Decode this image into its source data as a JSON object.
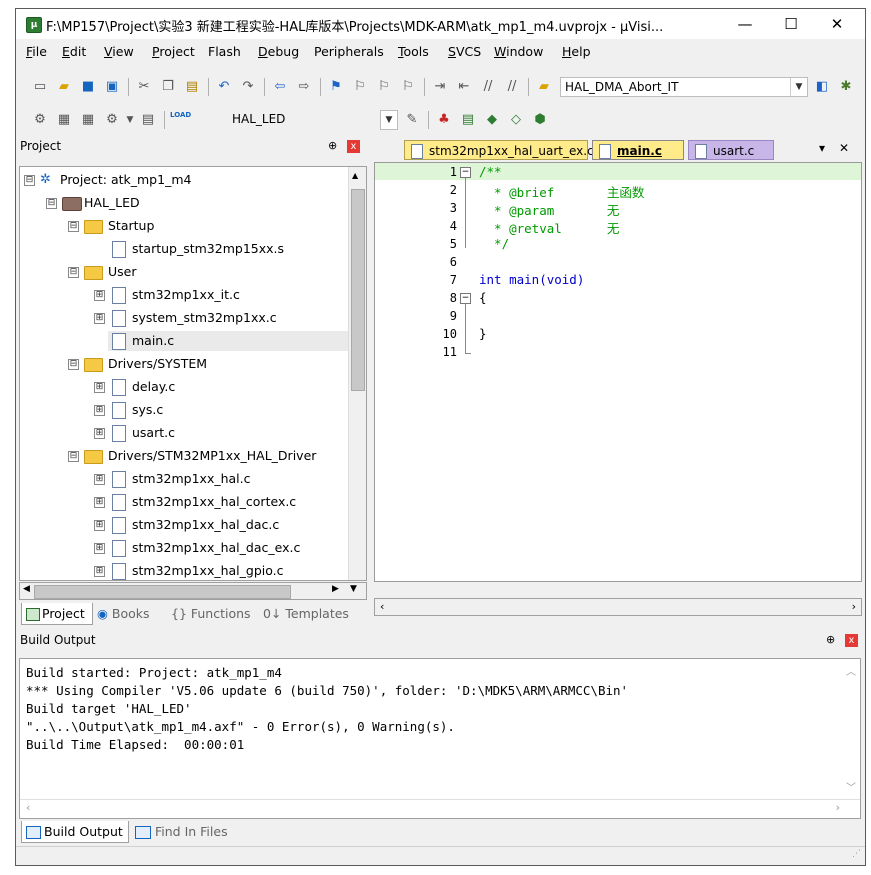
{
  "window": {
    "title": "F:\\MP157\\Project\\实验3 新建工程实验-HAL库版本\\Projects\\MDK-ARM\\atk_mp1_m4.uvprojx - µVisi...",
    "minimize": "—",
    "maximize": "☐",
    "close": "✕"
  },
  "menu": [
    {
      "mnemonic": "F",
      "rest": "ile"
    },
    {
      "mnemonic": "E",
      "rest": "dit"
    },
    {
      "mnemonic": "V",
      "rest": "iew"
    },
    {
      "mnemonic": "P",
      "rest": "roject"
    },
    {
      "mnemonic": "",
      "rest": "Flash"
    },
    {
      "mnemonic": "D",
      "rest": "ebug"
    },
    {
      "mnemonic": "",
      "rest": "Peripherals"
    },
    {
      "mnemonic": "T",
      "rest": "ools"
    },
    {
      "mnemonic": "S",
      "rest": "VCS"
    },
    {
      "mnemonic": "W",
      "rest": "indow"
    },
    {
      "mnemonic": "H",
      "rest": "elp"
    }
  ],
  "toolbar1": {
    "function_combo": "HAL_DMA_Abort_IT"
  },
  "toolbar2": {
    "target_combo": "HAL_LED",
    "load_label": "LOAD"
  },
  "project_panel": {
    "title": "Project",
    "pin": "⊕",
    "close": "x",
    "tree": [
      {
        "label": "Project: atk_mp1_m4",
        "kind": "project",
        "expander": "⊟"
      },
      {
        "label": "HAL_LED",
        "kind": "target",
        "expander": "⊟"
      },
      {
        "label": "Startup",
        "kind": "folder",
        "expander": "⊟"
      },
      {
        "label": "startup_stm32mp15xx.s",
        "kind": "file",
        "expander": ""
      },
      {
        "label": "User",
        "kind": "folder",
        "expander": "⊟"
      },
      {
        "label": "stm32mp1xx_it.c",
        "kind": "file",
        "expander": "⊞"
      },
      {
        "label": "system_stm32mp1xx.c",
        "kind": "file",
        "expander": "⊞"
      },
      {
        "label": "main.c",
        "kind": "file",
        "expander": ""
      },
      {
        "label": "Drivers/SYSTEM",
        "kind": "folder",
        "expander": "⊟"
      },
      {
        "label": "delay.c",
        "kind": "file",
        "expander": "⊞"
      },
      {
        "label": "sys.c",
        "kind": "file",
        "expander": "⊞"
      },
      {
        "label": "usart.c",
        "kind": "file",
        "expander": "⊞"
      },
      {
        "label": "Drivers/STM32MP1xx_HAL_Driver",
        "kind": "folder",
        "expander": "⊟"
      },
      {
        "label": "stm32mp1xx_hal.c",
        "kind": "keyfile",
        "expander": "⊞"
      },
      {
        "label": "stm32mp1xx_hal_cortex.c",
        "kind": "file",
        "expander": "⊞"
      },
      {
        "label": "stm32mp1xx_hal_dac.c",
        "kind": "file",
        "expander": "⊞"
      },
      {
        "label": "stm32mp1xx_hal_dac_ex.c",
        "kind": "file",
        "expander": "⊞"
      },
      {
        "label": "stm32mp1xx_hal_gpio.c",
        "kind": "file",
        "expander": "⊞"
      }
    ],
    "bottom_tabs": [
      "Project",
      "Books",
      "{} Functions",
      "0↓ Templates"
    ]
  },
  "editor": {
    "tabs": [
      {
        "label": "stm32mp1xx_hal_uart_ex.c",
        "color": "#ffeb8a"
      },
      {
        "label": "main.c",
        "color": "#ffeb8a"
      },
      {
        "label": "usart.c",
        "color": "#c9b6e8"
      }
    ],
    "tab_menu": "▾",
    "tab_close": "✕",
    "line_numbers": [
      "1",
      "2",
      "3",
      "4",
      "5",
      "6",
      "7",
      "8",
      "9",
      "10",
      "11"
    ],
    "code": [
      "/**",
      "  * @brief       主函数",
      "  * @param       无",
      "  * @retval      无",
      "  */",
      "",
      "int main(void)",
      "{",
      "",
      "}",
      ""
    ]
  },
  "build_output": {
    "title": "Build Output",
    "lines": [
      "Build started: Project: atk_mp1_m4",
      "*** Using Compiler 'V5.06 update 6 (build 750)', folder: 'D:\\MDK5\\ARM\\ARMCC\\Bin'",
      "Build target 'HAL_LED'",
      "\"..\\..\\Output\\atk_mp1_m4.axf\" - 0 Error(s), 0 Warning(s).",
      "Build Time Elapsed:  00:00:01"
    ],
    "tabs": [
      "Build Output",
      "Find In Files"
    ]
  }
}
